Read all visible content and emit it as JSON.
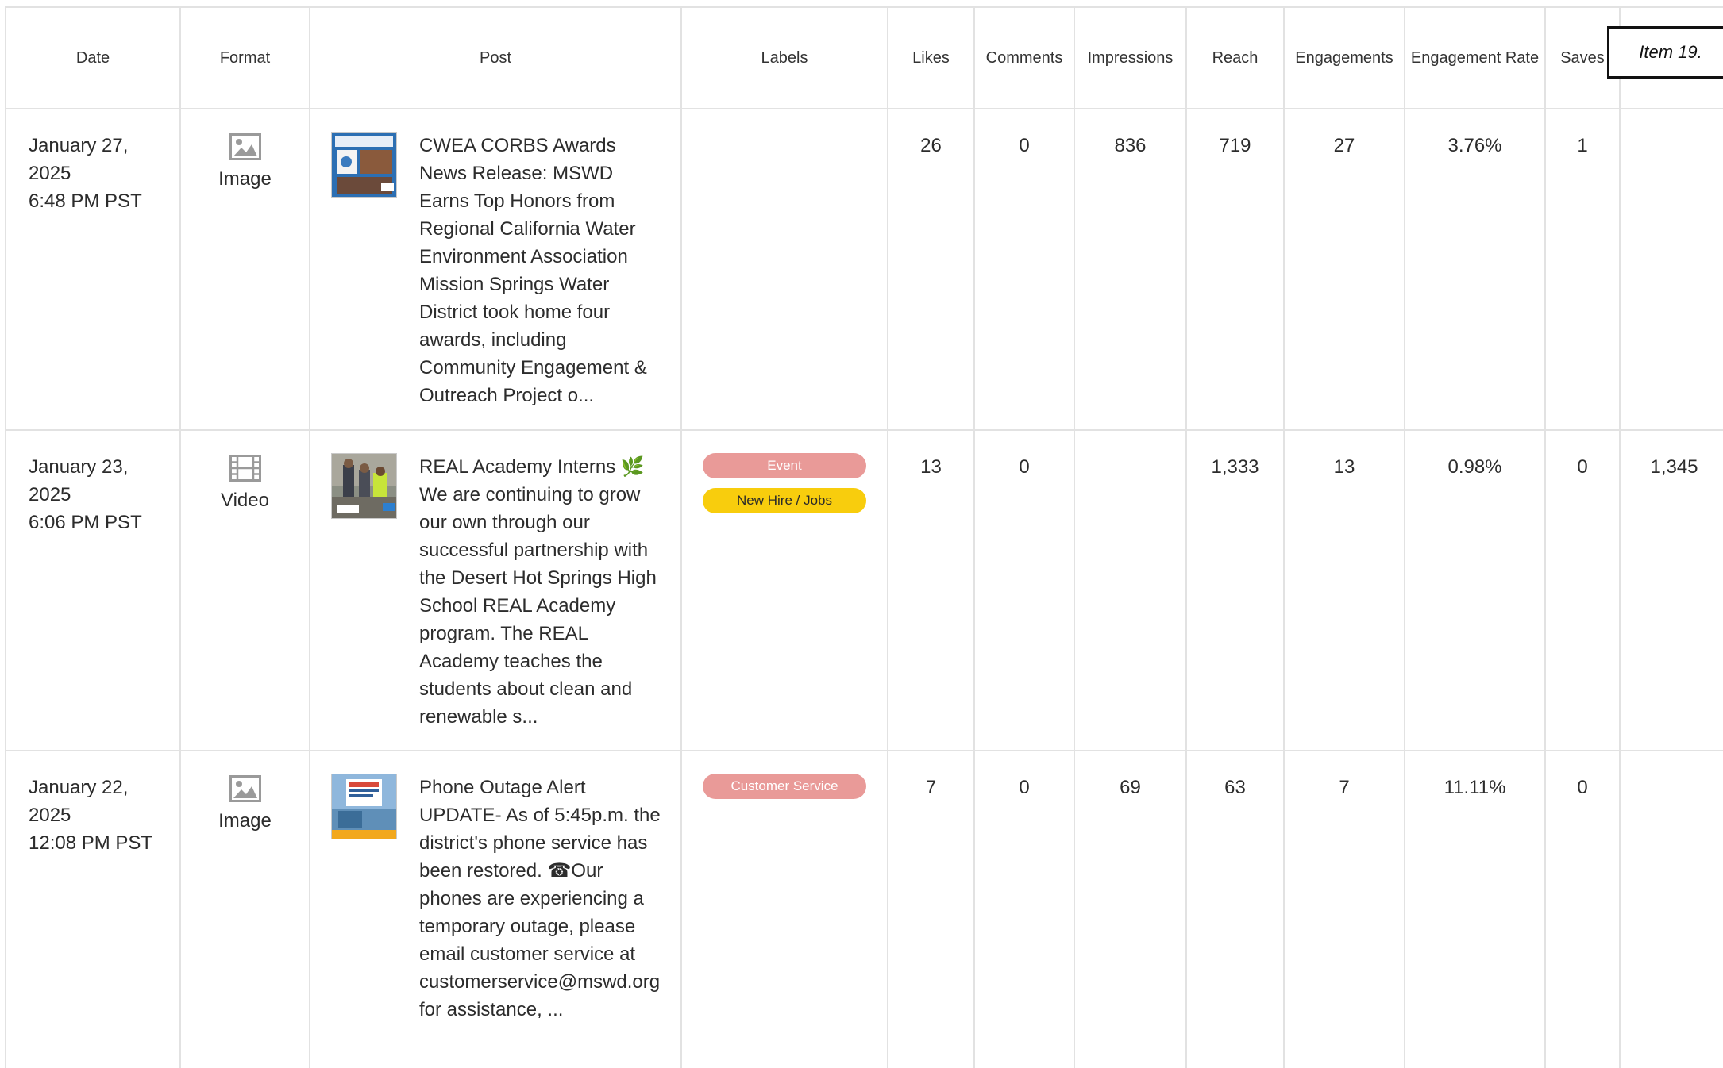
{
  "columns": [
    "Date",
    "Format",
    "Post",
    "Labels",
    "Likes",
    "Comments",
    "Impressions",
    "Reach",
    "Engagements",
    "Engagement Rate",
    "Saves"
  ],
  "item_box": "Item 19.",
  "colors": {
    "grid_border": "#e2e2e2",
    "label_event": "#e99a98",
    "label_new_hire": "#f8cd0d",
    "label_customer_service": "#e99a98",
    "icon_gray": "#9a9a9a"
  },
  "rows": [
    {
      "date_line1": "January 27,",
      "date_line2": "2025",
      "date_line3": "6:48 PM PST",
      "format": "Image",
      "format_icon": "image-icon",
      "post_text": "CWEA CORBS Awards News Release: MSWD Earns Top Honors from Regional California Water Environment Association Mission Springs Water District took home four awards, including Community Engagement & Outreach Project o...",
      "labels": [],
      "likes": "26",
      "comments": "0",
      "impressions": "836",
      "reach": "719",
      "engagements": "27",
      "engagement_rate": "3.76%",
      "saves": "1",
      "extra": ""
    },
    {
      "date_line1": "January 23,",
      "date_line2": "2025",
      "date_line3": "6:06 PM PST",
      "format": "Video",
      "format_icon": "video-icon",
      "post_text": "REAL Academy Interns 🌿We are continuing to grow our own through our successful partnership with the Desert Hot Springs High School REAL Academy program. The REAL Academy teaches the students about clean and renewable s...",
      "labels": [
        "Event",
        "New Hire / Jobs"
      ],
      "likes": "13",
      "comments": "0",
      "impressions": "",
      "reach": "1,333",
      "engagements": "13",
      "engagement_rate": "0.98%",
      "saves": "0",
      "extra": "1,345"
    },
    {
      "date_line1": "January 22,",
      "date_line2": "2025",
      "date_line3": "12:08 PM PST",
      "format": "Image",
      "format_icon": "image-icon",
      "post_text": "Phone Outage Alert UPDATE- As of 5:45p.m. the district's phone service has been restored. ☎Our phones are experiencing a temporary outage, please email customer service at customerservice@mswd.org for assistance, ...",
      "labels": [
        "Customer Service"
      ],
      "likes": "7",
      "comments": "0",
      "impressions": "69",
      "reach": "63",
      "engagements": "7",
      "engagement_rate": "11.11%",
      "saves": "0",
      "extra": ""
    }
  ]
}
